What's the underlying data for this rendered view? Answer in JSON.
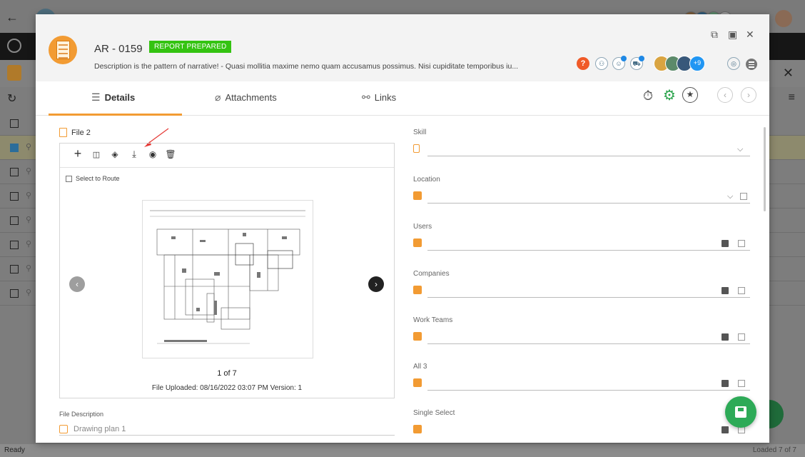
{
  "app": {
    "status": "Ready",
    "loaded": "Loaded 7 of 7"
  },
  "modal": {
    "record_id": "AR - 0159",
    "status_badge": "REPORT PREPARED",
    "description": "Description is the pattern of narrative!  - Quasi mollitia maxime nemo quam accusamus possimus. Nisi cupiditate temporibus iu...",
    "avatar_more": "+9",
    "help": "?",
    "colors": {
      "accent": "#f29b33",
      "badge": "#34c311",
      "fab": "#2daa57"
    }
  },
  "tabs": [
    {
      "label": "Details",
      "icon": "details-icon"
    },
    {
      "label": "Attachments",
      "icon": "paperclip-icon"
    },
    {
      "label": "Links",
      "icon": "link-icon"
    }
  ],
  "file": {
    "title": "File 2",
    "select_route": "Select to Route",
    "pager": "1 of 7",
    "uploaded": "File Uploaded: 08/16/2022  03:07 PM  Version: 1",
    "description_label": "File Description",
    "description_value": "Drawing plan 1"
  },
  "fields": [
    {
      "label": "Skill"
    },
    {
      "label": "Location"
    },
    {
      "label": "Users"
    },
    {
      "label": "Companies"
    },
    {
      "label": "Work Teams"
    },
    {
      "label": "All 3"
    },
    {
      "label": "Single Select"
    }
  ]
}
